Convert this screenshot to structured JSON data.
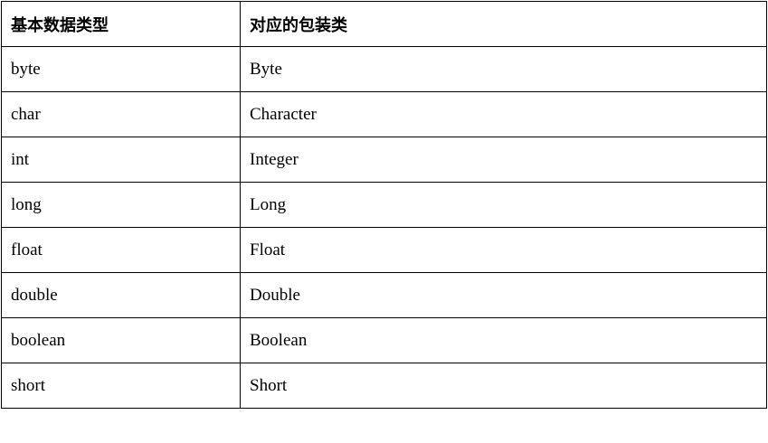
{
  "table": {
    "headers": [
      "基本数据类型",
      "对应的包装类"
    ],
    "rows": [
      [
        "byte",
        "Byte"
      ],
      [
        "char",
        "Character"
      ],
      [
        "int",
        "Integer"
      ],
      [
        "long",
        "Long"
      ],
      [
        "float",
        "Float"
      ],
      [
        "double",
        "Double"
      ],
      [
        "boolean",
        "Boolean"
      ],
      [
        "short",
        "Short"
      ]
    ]
  }
}
